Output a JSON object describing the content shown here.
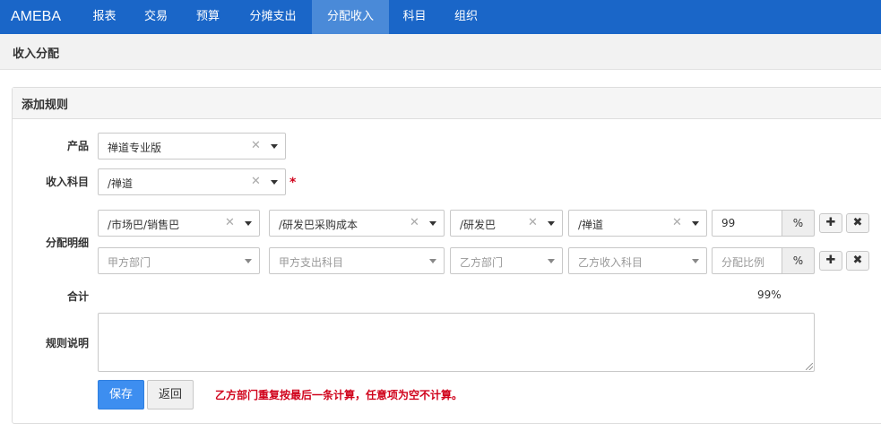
{
  "app": {
    "brand": "AMEBA"
  },
  "nav": {
    "items": [
      {
        "label": "报表"
      },
      {
        "label": "交易"
      },
      {
        "label": "预算"
      },
      {
        "label": "分摊支出"
      },
      {
        "label": "分配收入",
        "active": true
      },
      {
        "label": "科目"
      },
      {
        "label": "组织"
      }
    ]
  },
  "page": {
    "title": "收入分配"
  },
  "form": {
    "panel_title": "添加规则",
    "product": {
      "label": "产品",
      "value": "禅道专业版"
    },
    "income_account": {
      "label": "收入科目",
      "value": "/禅道",
      "required_mark": "*"
    },
    "allocation": {
      "label": "分配明细",
      "rows": [
        {
          "payer_dept": "/市场巴/销售巴",
          "payer_account": "/研发巴采购成本",
          "payee_dept": "/研发巴",
          "payee_account": "/禅道",
          "ratio": "99",
          "ratio_unit": "%"
        },
        {
          "payer_dept": "",
          "payer_account": "",
          "payee_dept": "",
          "payee_account": "",
          "ratio": "",
          "ratio_unit": "%"
        }
      ],
      "placeholders": {
        "payer_dept": "甲方部门",
        "payer_account": "甲方支出科目",
        "payee_dept": "乙方部门",
        "payee_account": "乙方收入科目",
        "ratio": "分配比例"
      },
      "add_icon": "plus-icon",
      "remove_icon": "close-icon"
    },
    "total": {
      "label": "合计",
      "value": "99%"
    },
    "description": {
      "label": "规则说明",
      "value": ""
    },
    "save_label": "保存",
    "back_label": "返回",
    "hint": "乙方部门重复按最后一条计算，任意项为空不计算。"
  },
  "colors": {
    "nav_bg": "#1a66c8",
    "nav_active": "#4a8ad8",
    "primary": "#3d8ef0",
    "danger": "#d0021b"
  }
}
